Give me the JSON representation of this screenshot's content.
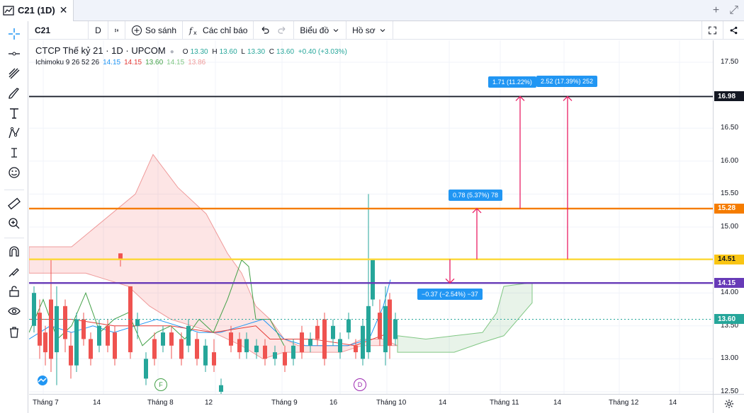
{
  "window": {
    "tab_title": "C21 (1D)",
    "close": "✕",
    "add": "+",
    "expand": "⤢"
  },
  "toolbar": {
    "symbol": "C21",
    "interval": "D",
    "compare": "So sánh",
    "indicators": "Các chỉ báo",
    "chart_type": "Biểu đồ",
    "profile": "Hồ sơ"
  },
  "legend": {
    "name": "CTCP Thế kỷ 21 · 1D · UPCOM",
    "ohlc": {
      "o_label": "O",
      "o": "13.30",
      "h_label": "H",
      "h": "13.60",
      "l_label": "L",
      "l": "13.30",
      "c_label": "C",
      "c": "13.60",
      "change": "+0.40 (+3.03%)"
    },
    "ichimoku": {
      "label": "Ichimoku 9 26 52 26",
      "values": [
        "14.15",
        "14.15",
        "13.60",
        "14.15",
        "13.86"
      ],
      "colors": [
        "#2196f3",
        "#e53935",
        "#43a047",
        "#81c784",
        "#ef9a9a"
      ]
    }
  },
  "price_axis": {
    "ticks": [
      "17.50",
      "17.00",
      "16.50",
      "16.00",
      "15.50",
      "15.00",
      "14.50",
      "14.00",
      "13.50",
      "13.00",
      "12.50"
    ]
  },
  "price_tags": [
    {
      "value": "16.98",
      "color": "#131722"
    },
    {
      "value": "15.28",
      "color": "#f57c00"
    },
    {
      "value": "14.51",
      "color": "#f9c513"
    },
    {
      "value": "14.15",
      "color": "#673ab7"
    },
    {
      "value": "13.60",
      "color": "#26a69a"
    }
  ],
  "time_axis": {
    "labels": [
      "Tháng 7",
      "14",
      "Tháng 8",
      "12",
      "Tháng 9",
      "16",
      "Tháng 10",
      "14",
      "Tháng 11",
      "14",
      "Tháng 12",
      "14"
    ]
  },
  "callouts": [
    "1.71 (11.22%)",
    "2.52 (17.39%) 252",
    "0.78 (5.37%) 78",
    "−0.37 (−2.54%) −37"
  ],
  "events": [
    {
      "letter": "F",
      "color": "#43a047"
    },
    {
      "letter": "D",
      "color": "#9c27b0"
    }
  ],
  "colors": {
    "up": "#26a69a",
    "down": "#ef5350",
    "accent": "#2196f3"
  }
}
